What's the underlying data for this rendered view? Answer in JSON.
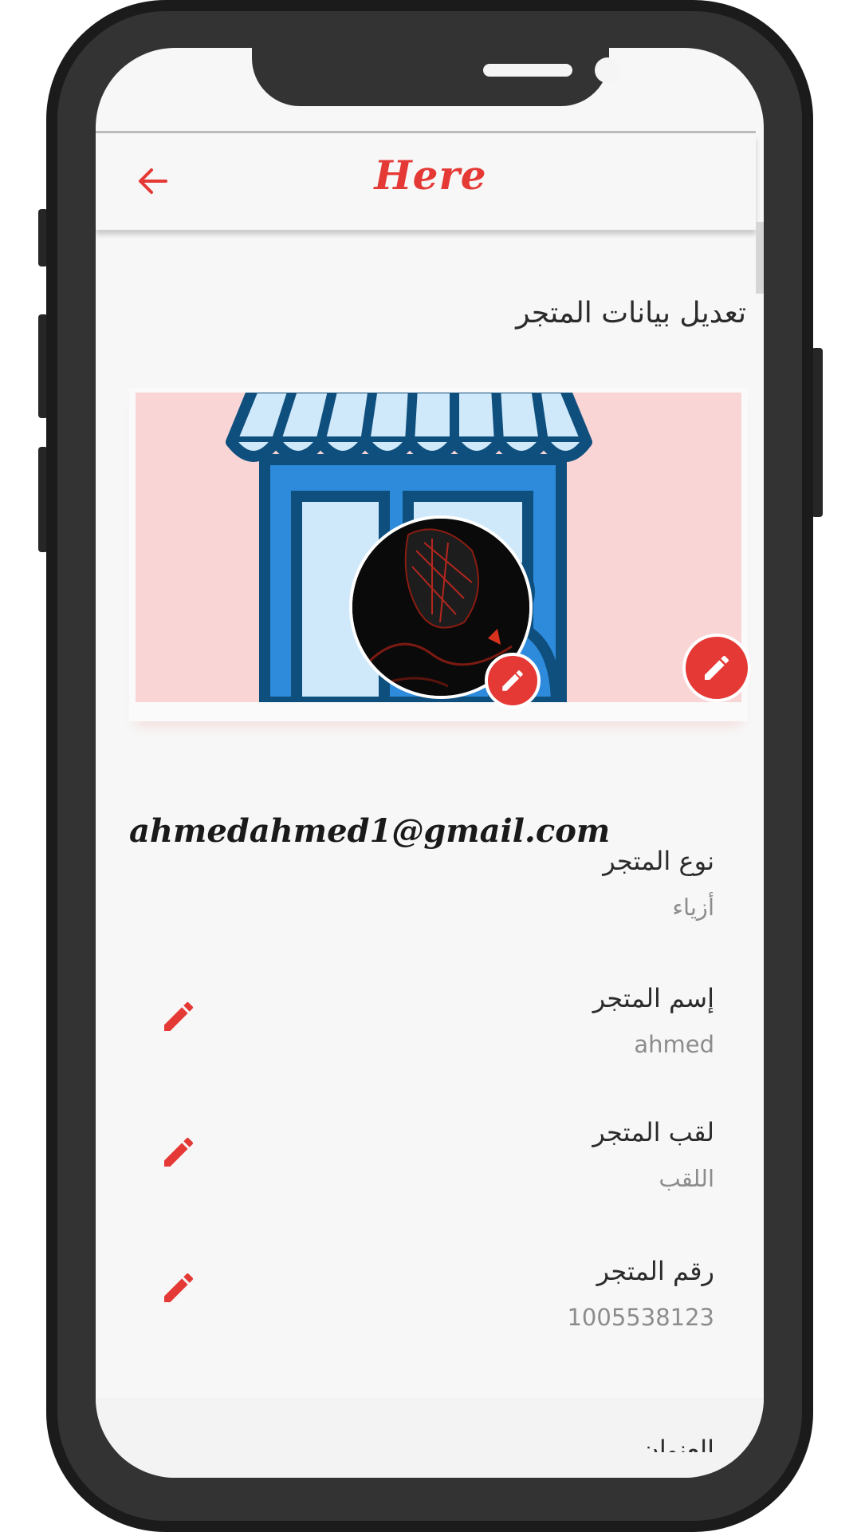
{
  "app": {
    "title": "Here"
  },
  "page": {
    "title": "تعديل بيانات المتجر"
  },
  "profile": {
    "email": "ahmedahmed1@gmail.com"
  },
  "fields": [
    {
      "label": "نوع المتجر",
      "value": "أزياء",
      "editable": false
    },
    {
      "label": "إسم المتجر",
      "value": "ahmed",
      "editable": true
    },
    {
      "label": "لقب المتجر",
      "value": "اللقب",
      "editable": true
    },
    {
      "label": "رقم المتجر",
      "value": "1005538123",
      "editable": true
    }
  ],
  "partial_field": {
    "label": "العنوان"
  },
  "colors": {
    "accent": "#e53935",
    "cover_bg": "#f9d5d6",
    "store_blue": "#2e8bdc",
    "store_dark": "#0f4f7d",
    "store_light": "#cfe9fb"
  },
  "icons": {
    "back": "arrow-left-icon",
    "edit": "pencil-icon",
    "cover": "store-icon"
  }
}
